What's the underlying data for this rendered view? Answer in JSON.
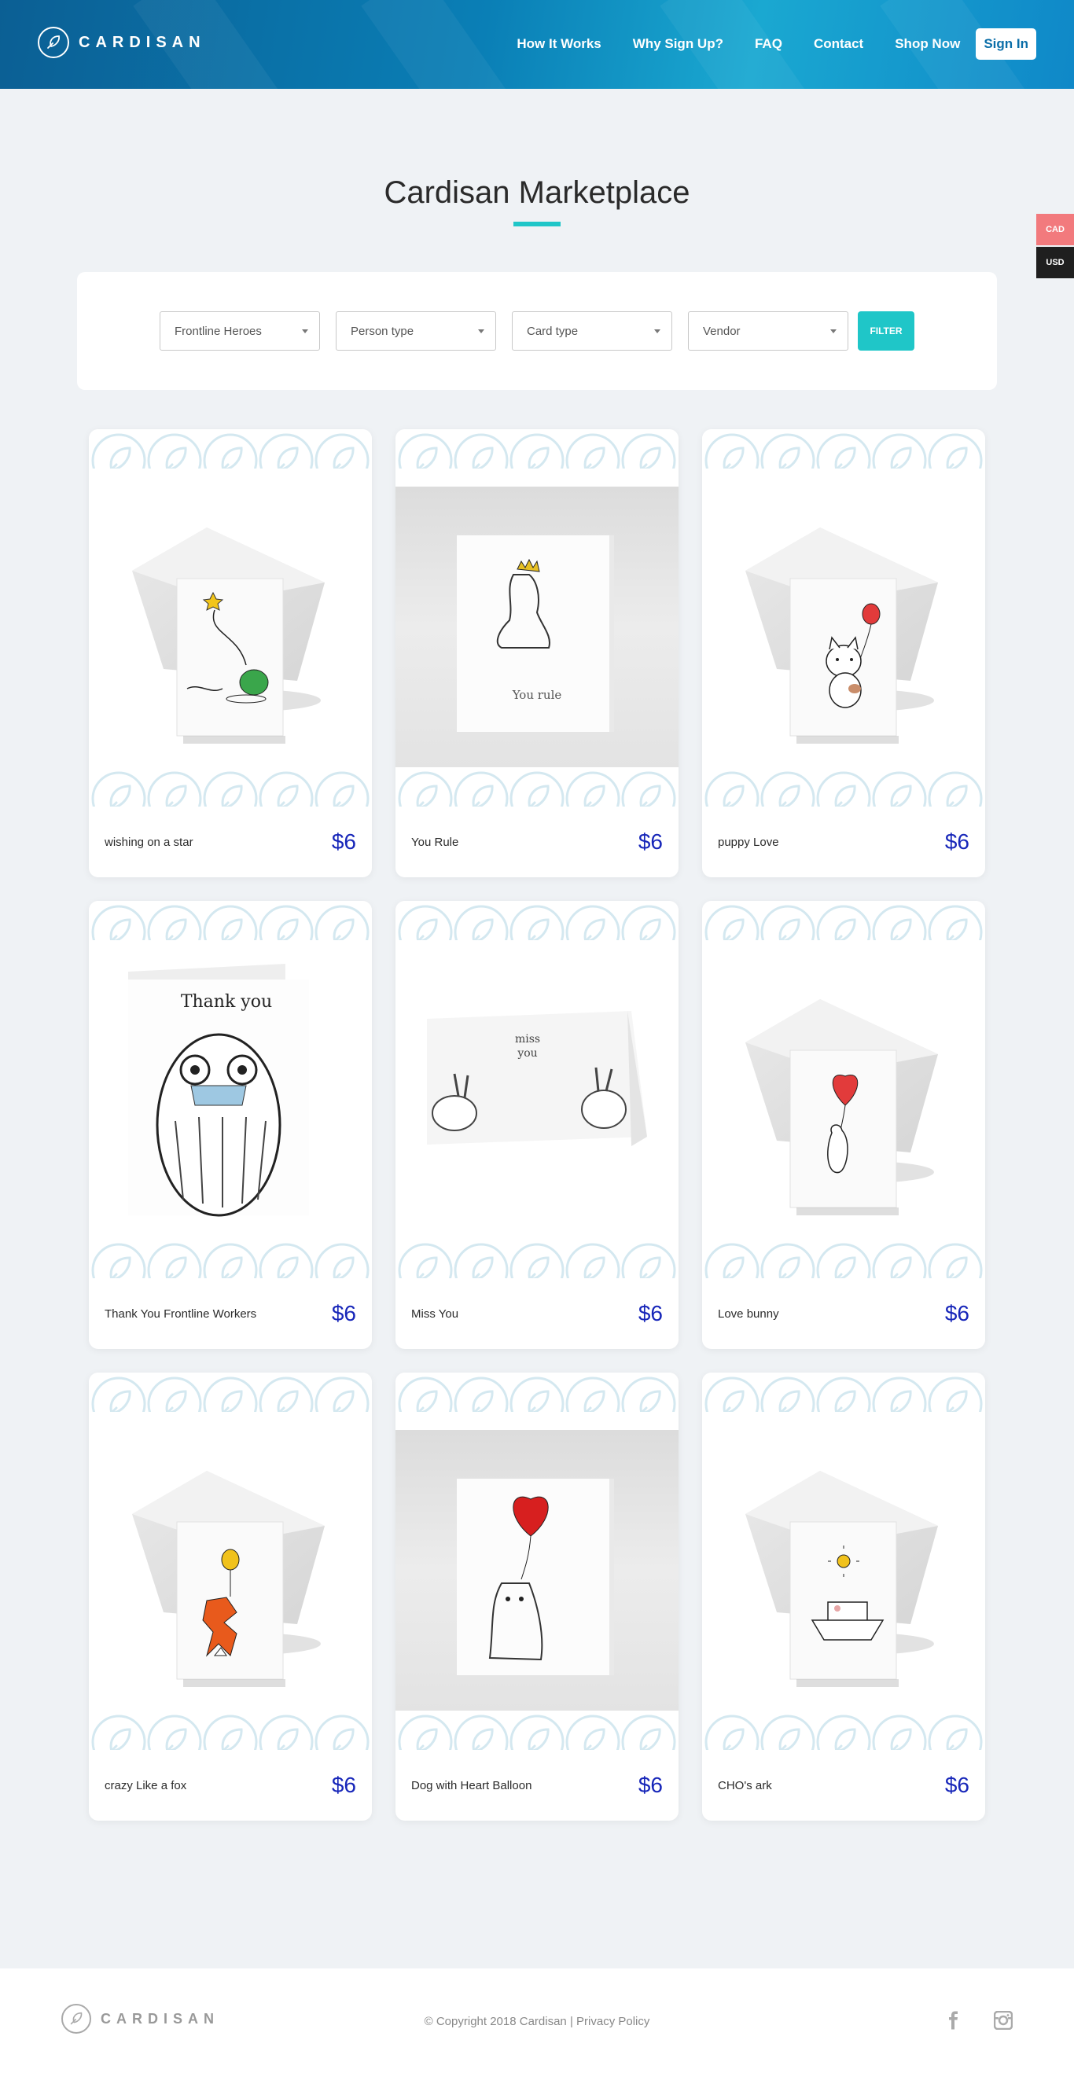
{
  "header": {
    "logo_text": "CARDISAN",
    "nav": [
      "How It Works",
      "Why Sign Up?",
      "FAQ",
      "Contact",
      "Shop Now"
    ],
    "signin_label": "Sign In"
  },
  "currency": {
    "cad": "CAD",
    "usd": "USD"
  },
  "page_title": "Cardisan Marketplace",
  "filters": {
    "category": "Frontline Heroes",
    "person_type": "Person type",
    "card_type": "Card type",
    "vendor": "Vendor",
    "button": "FILTER"
  },
  "cards": [
    {
      "name": "wishing on a star",
      "price": "$6",
      "art": "frog-star-card"
    },
    {
      "name": "You Rule",
      "price": "$6",
      "art": "cat-crown-card",
      "card_text": "You rule"
    },
    {
      "name": "puppy Love",
      "price": "$6",
      "art": "puppy-balloon-card"
    },
    {
      "name": "Thank You Frontline Workers",
      "price": "$6",
      "art": "owl-mask-card",
      "card_text": "Thank you"
    },
    {
      "name": "Miss You",
      "price": "$6",
      "art": "bunnies-card",
      "card_text": "miss you"
    },
    {
      "name": "Love bunny",
      "price": "$6",
      "art": "bunny-heart-card"
    },
    {
      "name": "crazy Like a fox",
      "price": "$6",
      "art": "fox-balloon-card"
    },
    {
      "name": "Dog with Heart Balloon",
      "price": "$6",
      "art": "dog-heart-card"
    },
    {
      "name": "CHO's ark",
      "price": "$6",
      "art": "ark-card"
    }
  ],
  "footer": {
    "logo_text": "CARDISAN",
    "copyright": "© Copyright 2018 Cardisan | ",
    "privacy": "Privacy Policy"
  },
  "colors": {
    "accent": "#1fc6c8",
    "price": "#1726b9",
    "header_start": "#0b5f94",
    "header_end": "#0f88c8"
  }
}
